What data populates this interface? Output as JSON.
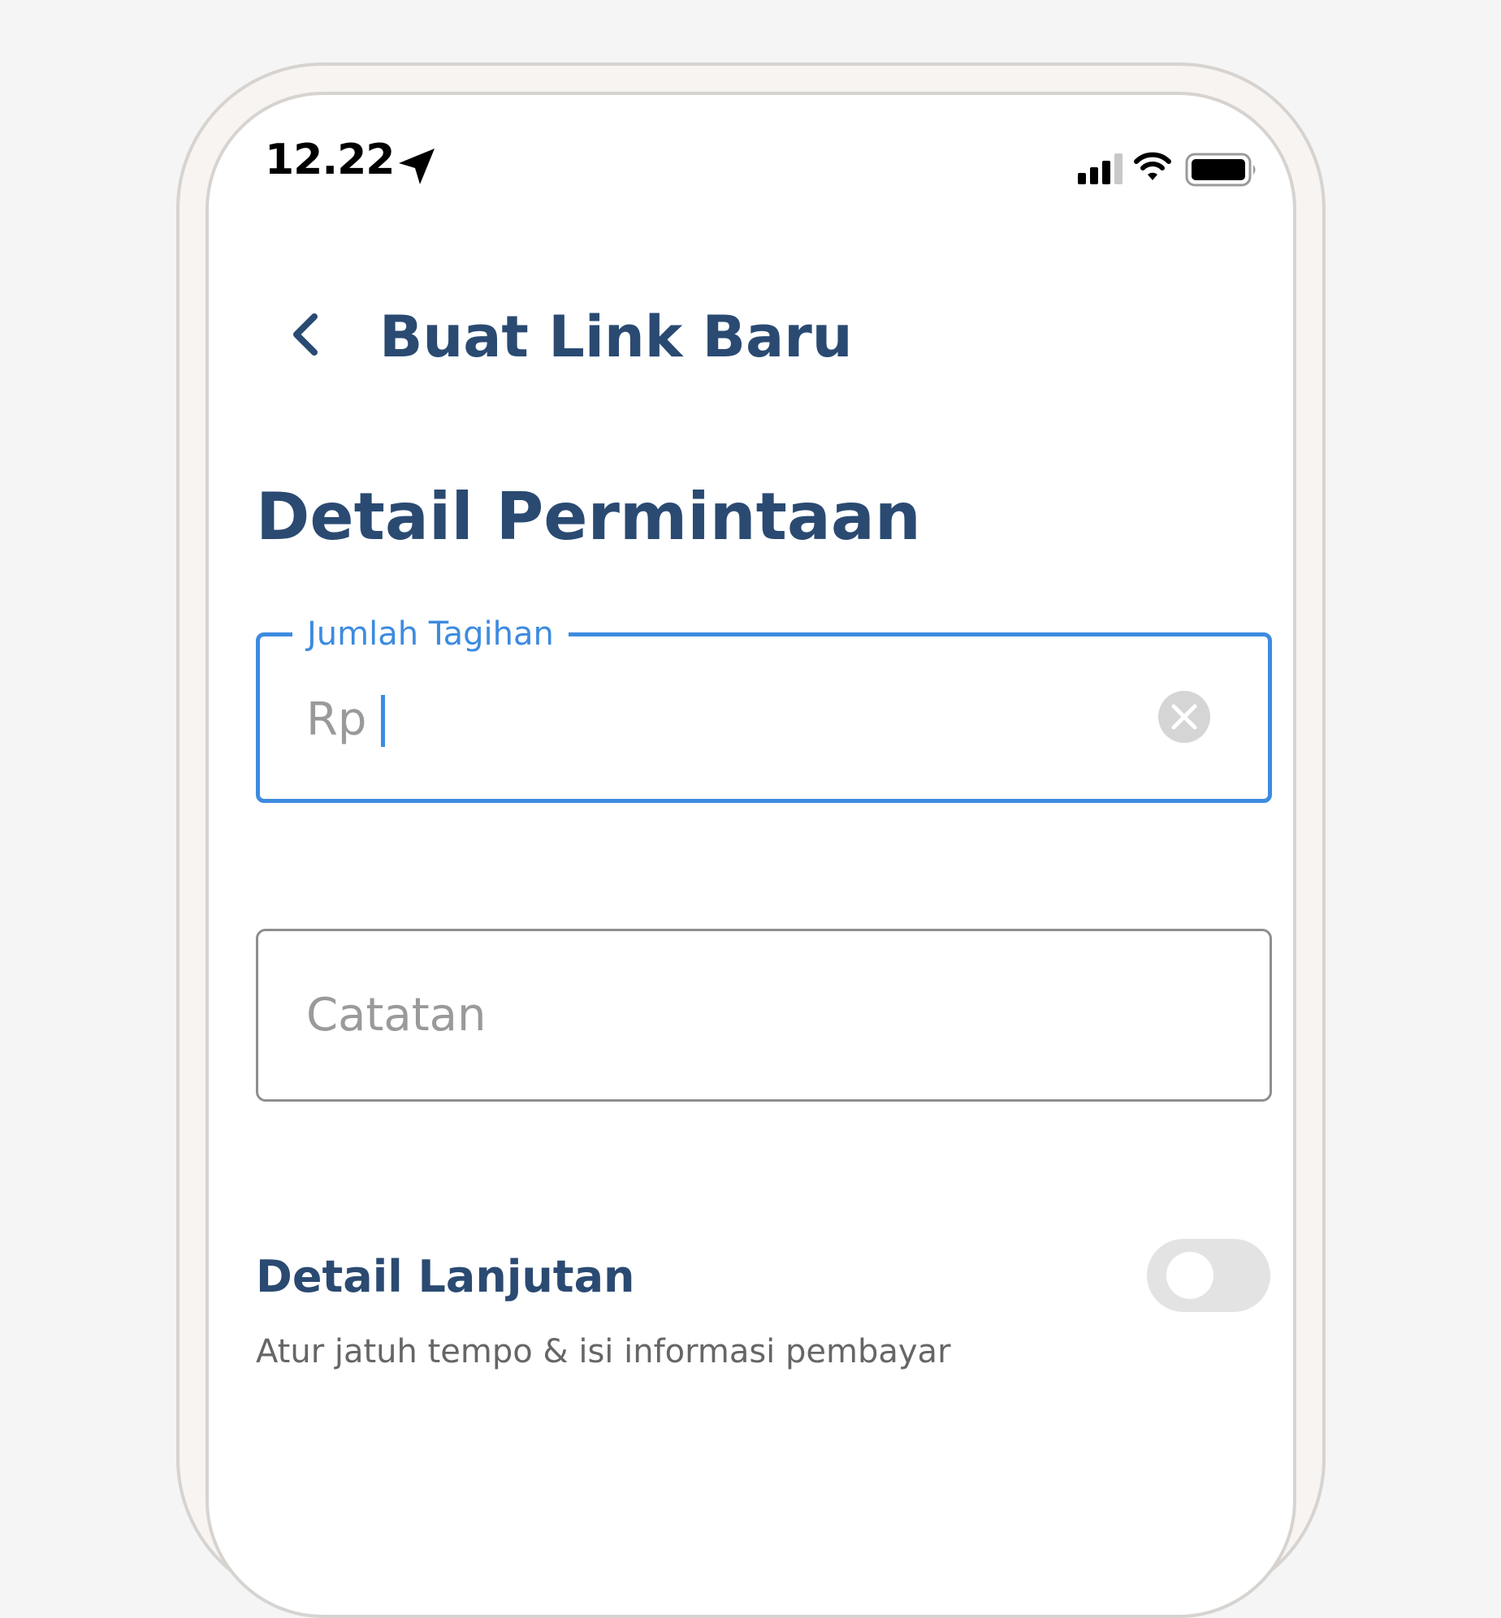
{
  "status_bar": {
    "time": "12.22",
    "icons": [
      "location-arrow-icon",
      "cellular-signal-icon",
      "wifi-icon",
      "battery-icon"
    ]
  },
  "header": {
    "back_icon": "chevron-left-icon",
    "title": "Buat Link Baru"
  },
  "section": {
    "title": "Detail Permintaan"
  },
  "form": {
    "amount": {
      "label": "Jumlah Tagihan",
      "prefix": "Rp",
      "value": "",
      "focused": true,
      "clear_icon": "close-circle-icon"
    },
    "notes": {
      "placeholder": "Catatan",
      "value": ""
    }
  },
  "advanced": {
    "title": "Detail Lanjutan",
    "subtitle": "Atur jatuh tempo & isi informasi pembayar",
    "toggle_on": false
  },
  "colors": {
    "primary_text": "#2a4a72",
    "focus_blue": "#3d8be0",
    "placeholder_gray": "#9a9a9a",
    "subtitle_gray": "#666666",
    "toggle_off_bg": "#e3e3e3",
    "page_bg": "#f5f5f5"
  }
}
